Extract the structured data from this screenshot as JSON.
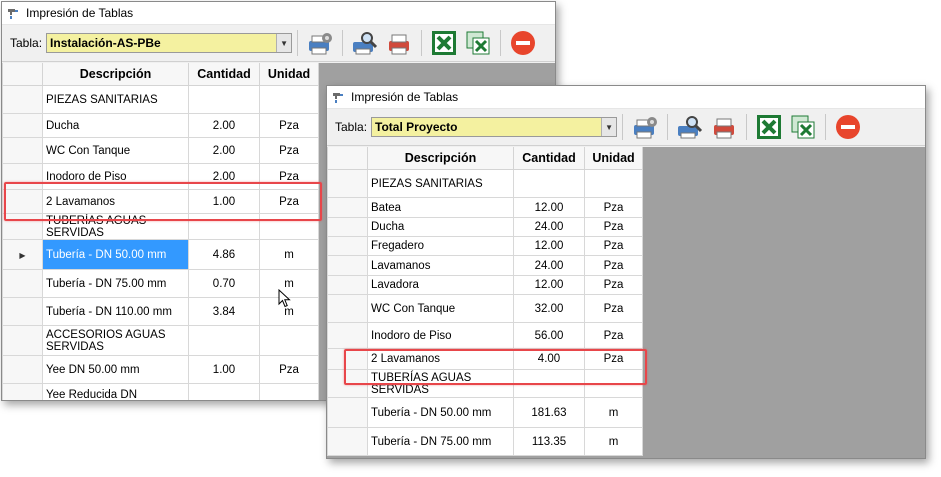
{
  "window1": {
    "title": "Impresión de Tablas",
    "toolbar": {
      "table_label": "Tabla:",
      "table_value": "Instalación-AS-PBe"
    },
    "columns": [
      "Descripción",
      "Cantidad",
      "Unidad"
    ],
    "rows": [
      {
        "desc": "PIEZAS SANITARIAS",
        "qty": "",
        "unit": ""
      },
      {
        "desc": "Ducha",
        "qty": "2.00",
        "unit": "Pza"
      },
      {
        "desc": "WC Con Tanque",
        "qty": "2.00",
        "unit": "Pza"
      },
      {
        "desc": "Inodoro de Piso",
        "qty": "2.00",
        "unit": "Pza"
      },
      {
        "desc": "2 Lavamanos",
        "qty": "1.00",
        "unit": "Pza"
      },
      {
        "desc": "TUBERÍAS AGUAS SERVIDAS",
        "qty": "",
        "unit": ""
      },
      {
        "desc": "Tubería - DN 50.00 mm",
        "qty": "4.86",
        "unit": "m"
      },
      {
        "desc": "Tubería - DN 75.00 mm",
        "qty": "0.70",
        "unit": "m"
      },
      {
        "desc": "Tubería - DN 110.00 mm",
        "qty": "3.84",
        "unit": "m"
      },
      {
        "desc": "ACCESORIOS AGUAS SERVIDAS",
        "qty": "",
        "unit": ""
      },
      {
        "desc": "Yee DN 50.00 mm",
        "qty": "1.00",
        "unit": "Pza"
      },
      {
        "desc": "Yee Reducida DN",
        "qty": "",
        "unit": ""
      }
    ]
  },
  "window2": {
    "title": "Impresión de Tablas",
    "toolbar": {
      "table_label": "Tabla:",
      "table_value": "Total Proyecto"
    },
    "columns": [
      "Descripción",
      "Cantidad",
      "Unidad"
    ],
    "rows": [
      {
        "desc": "PIEZAS SANITARIAS",
        "qty": "",
        "unit": ""
      },
      {
        "desc": "Batea",
        "qty": "12.00",
        "unit": "Pza"
      },
      {
        "desc": "Ducha",
        "qty": "24.00",
        "unit": "Pza"
      },
      {
        "desc": "Fregadero",
        "qty": "12.00",
        "unit": "Pza"
      },
      {
        "desc": "Lavamanos",
        "qty": "24.00",
        "unit": "Pza"
      },
      {
        "desc": "Lavadora",
        "qty": "12.00",
        "unit": "Pza"
      },
      {
        "desc": "WC Con Tanque",
        "qty": "32.00",
        "unit": "Pza"
      },
      {
        "desc": "Inodoro de Piso",
        "qty": "56.00",
        "unit": "Pza"
      },
      {
        "desc": "2 Lavamanos",
        "qty": "4.00",
        "unit": "Pza"
      },
      {
        "desc": "TUBERÍAS AGUAS SERVIDAS",
        "qty": "",
        "unit": ""
      },
      {
        "desc": "Tubería - DN 50.00 mm",
        "qty": "181.63",
        "unit": "m"
      },
      {
        "desc": "Tubería - DN 75.00 mm",
        "qty": "113.35",
        "unit": "m"
      }
    ]
  },
  "colors": {
    "combo_bg": "#f4f1a0",
    "selection": "#3399ff",
    "highlight": "#e8464a",
    "excel_green": "#1e7a34",
    "stop_red": "#e8452c"
  },
  "icons": [
    "printer-settings-icon",
    "print-preview-icon",
    "print-icon",
    "excel-export-icon",
    "excel-export-alt-icon",
    "stop-icon"
  ]
}
